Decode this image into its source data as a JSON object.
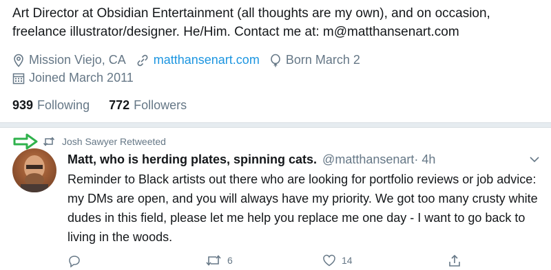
{
  "profile": {
    "bio": "Art Director at Obsidian Entertainment (all thoughts are my own), and on occasion, freelance illustrator/designer. He/Him. Contact me at: m@matthansenart.com",
    "location": "Mission Viejo, CA",
    "website": "matthansenart.com",
    "birthday": "Born March 2",
    "joined": "Joined March 2011",
    "following_count": "939",
    "following_label": "Following",
    "followers_count": "772",
    "followers_label": "Followers"
  },
  "tweet": {
    "retweeted_by": "Josh Sawyer Retweeted",
    "author_name": "Matt, who is herding plates, spinning cats.",
    "author_handle": "@matthansenart",
    "time": " · 4h",
    "text": "Reminder to Black artists out there who are looking for portfolio reviews or job advice: my DMs are open, and you will always have my priority. We got too many crusty white dudes in this field, please let me help you replace me one day - I want to go back to living in the woods.",
    "retweet_count": "6",
    "like_count": "14"
  },
  "icons": {
    "location": "location-pin-icon",
    "link": "link-icon",
    "birthday": "balloon-icon",
    "calendar": "calendar-icon",
    "retweet": "retweet-icon",
    "reply": "reply-icon",
    "like": "heart-icon",
    "share": "share-icon",
    "caret": "chevron-down-icon",
    "annotation": "green-arrow-icon"
  },
  "colors": {
    "link": "#1b95e0",
    "secondary_text": "#657786",
    "annotation_arrow": "#2fb24c"
  }
}
